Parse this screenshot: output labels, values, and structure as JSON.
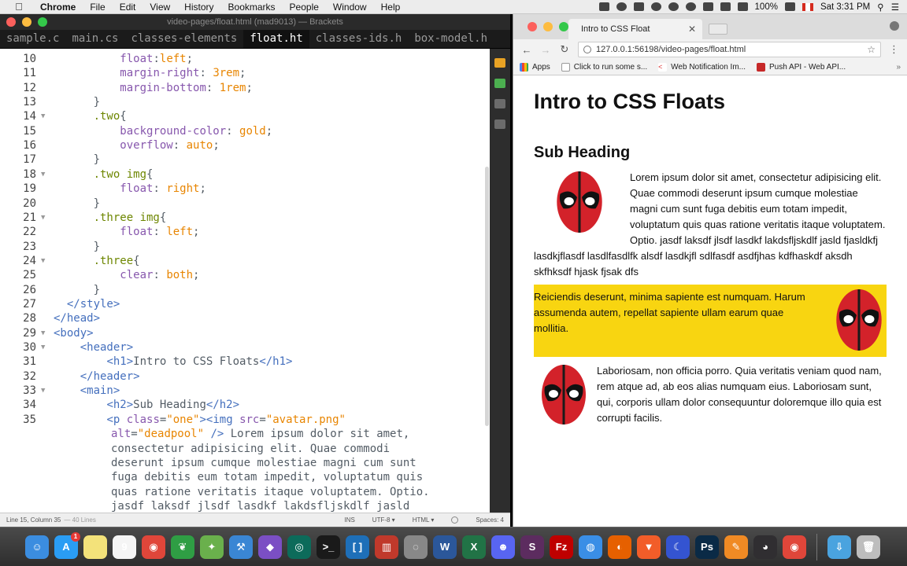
{
  "menubar": {
    "apple": "",
    "items": [
      "Chrome",
      "File",
      "Edit",
      "View",
      "History",
      "Bookmarks",
      "People",
      "Window",
      "Help"
    ],
    "battery": "100%",
    "clock": "Sat 3:31 PM"
  },
  "editor": {
    "window_title": "video-pages/float.html (mad9013) — Brackets",
    "tabs": [
      "sample.c",
      "main.cs",
      "classes-elements",
      "float.ht",
      "classes-ids.h",
      "box-model.h"
    ],
    "active_tab_index": 3,
    "lines": [
      {
        "n": "10",
        "fold": "",
        "html": "          <span class=\"kw\">float</span>:<span class=\"str\">left</span>;"
      },
      {
        "n": "11",
        "fold": "",
        "html": "          <span class=\"kw\">margin-right</span>: <span class=\"str\">3rem</span>;"
      },
      {
        "n": "12",
        "fold": "",
        "html": "          <span class=\"kw\">margin-bottom</span>: <span class=\"str\">1rem</span>;"
      },
      {
        "n": "13",
        "fold": "",
        "html": "      }"
      },
      {
        "n": "14",
        "fold": "▼",
        "html": "      <span class=\"sel\">.two</span>{"
      },
      {
        "n": "15",
        "fold": "",
        "html": "          <span class=\"kw\">background-color</span>: <span class=\"str\">gold</span>;"
      },
      {
        "n": "16",
        "fold": "",
        "html": "          <span class=\"kw\">overflow</span>: <span class=\"str\">auto</span>;"
      },
      {
        "n": "17",
        "fold": "",
        "html": "      }"
      },
      {
        "n": "18",
        "fold": "▼",
        "html": "      <span class=\"sel\">.two img</span>{"
      },
      {
        "n": "19",
        "fold": "",
        "html": "          <span class=\"kw\">float</span>: <span class=\"str\">right</span>;"
      },
      {
        "n": "20",
        "fold": "",
        "html": "      }"
      },
      {
        "n": "21",
        "fold": "▼",
        "html": "      <span class=\"sel\">.three img</span>{"
      },
      {
        "n": "22",
        "fold": "",
        "html": "          <span class=\"kw\">float</span>: <span class=\"str\">left</span>;"
      },
      {
        "n": "23",
        "fold": "",
        "html": "      }"
      },
      {
        "n": "24",
        "fold": "▼",
        "html": "      <span class=\"sel\">.three</span>{"
      },
      {
        "n": "25",
        "fold": "",
        "html": "          <span class=\"kw\">clear</span>: <span class=\"str\">both</span>;"
      },
      {
        "n": "26",
        "fold": "",
        "html": "      }"
      },
      {
        "n": "27",
        "fold": "",
        "html": "  <span class=\"tag\">&lt;/style&gt;</span>"
      },
      {
        "n": "28",
        "fold": "",
        "html": "<span class=\"tag\">&lt;/head&gt;</span>"
      },
      {
        "n": "29",
        "fold": "▼",
        "html": "<span class=\"tag\">&lt;body&gt;</span>"
      },
      {
        "n": "30",
        "fold": "▼",
        "html": "    <span class=\"tag\">&lt;header&gt;</span>"
      },
      {
        "n": "31",
        "fold": "",
        "html": "        <span class=\"tag\">&lt;h1&gt;</span>Intro to CSS Floats<span class=\"tag\">&lt;/h1&gt;</span>"
      },
      {
        "n": "32",
        "fold": "",
        "html": "    <span class=\"tag\">&lt;/header&gt;</span>"
      },
      {
        "n": "33",
        "fold": "▼",
        "html": "    <span class=\"tag\">&lt;main&gt;</span>"
      },
      {
        "n": "34",
        "fold": "",
        "html": "        <span class=\"tag\">&lt;h2&gt;</span>Sub Heading<span class=\"tag\">&lt;/h2&gt;</span>"
      },
      {
        "n": "35",
        "fold": "",
        "html": "        <span class=\"tag\">&lt;p</span> <span class=\"kw\">class</span>=<span class=\"str\">\"one\"</span><span class=\"tag\">&gt;&lt;img</span> <span class=\"kw\">src</span>=<span class=\"str\">\"avatar.png\"</span>"
      }
    ],
    "wrapped_html": "<span class=\"kw\">alt</span>=<span class=\"str\">\"deadpool\"</span> <span class=\"tag\">/&gt;</span> Lorem ipsum dolor sit amet,\nconsectetur adipisicing elit. Quae commodi\ndeserunt ipsum cumque molestiae magni cum sunt\nfuga debitis eum totam impedit, voluptatum quis\nquas ratione veritatis itaque voluptatem. Optio.\njasdf laksdf jlsdf lasdkf lakdsfljskdlf jasld",
    "status": {
      "position": "Line 15, Column 35",
      "lines": "— 40 Lines",
      "mode": "INS",
      "encoding": "UTF-8 ▾",
      "language": "HTML ▾",
      "spaces": "Spaces: 4"
    }
  },
  "browser": {
    "tab_title": "Intro to CSS Float",
    "tab_close": "✕",
    "url": "127.0.0.1:56198/video-pages/float.html",
    "bookmarks": [
      "Apps",
      "Click to run some s...",
      "Web Notification Im...",
      "Push API - Web API..."
    ],
    "page": {
      "h1": "Intro to CSS Floats",
      "h2": "Sub Heading",
      "p_one": "Lorem ipsum dolor sit amet, consectetur adipisicing elit. Quae commodi deserunt ipsum cumque molestiae magni cum sunt fuga debitis eum totam impedit, voluptatum quis quas ratione veritatis itaque voluptatem. Optio. jasdf laksdf jlsdf lasdkf lakdsfljskdlf jasld fjasldkfj lasdkjflasdf lasdlfasdlfk alsdf lasdkjfl sdlfasdf asdfjhas kdfhaskdf aksdh skfhksdf hjask fjsak dfs",
      "p_two": "Reiciendis deserunt, minima sapiente est numquam. Harum assumenda autem, repellat sapiente ullam earum quae mollitia.",
      "p_three": "Laboriosam, non officia porro. Quia veritatis veniam quod nam, rem atque ad, ab eos alias numquam eius. Laboriosam sunt, qui, corporis ullam dolor consequuntur doloremque illo quia est corrupti facilis.",
      "gold_color": "#f8d511"
    }
  },
  "dock": [
    {
      "name": "finder-icon",
      "color": "#3b8de0",
      "glyph": "☺"
    },
    {
      "name": "app-store-icon",
      "color": "#2a9df4",
      "glyph": "A",
      "badge": "1"
    },
    {
      "name": "notes-icon",
      "color": "#f3e27a",
      "glyph": ""
    },
    {
      "name": "calendar-icon",
      "color": "#f5f5f5",
      "glyph": "9"
    },
    {
      "name": "chrome-icon",
      "color": "#e0463a",
      "glyph": "◉"
    },
    {
      "name": "leaf-icon",
      "color": "#2f9e44",
      "glyph": "❦"
    },
    {
      "name": "sourcetree-icon",
      "color": "#6ab04c",
      "glyph": "✦"
    },
    {
      "name": "xcode-icon",
      "color": "#3a86d4",
      "glyph": "⚒"
    },
    {
      "name": "github-icon",
      "color": "#7b4fc4",
      "glyph": "◆"
    },
    {
      "name": "gitkraken-icon",
      "color": "#0c6b5a",
      "glyph": "◎"
    },
    {
      "name": "terminal-icon",
      "color": "#1a1a1a",
      "glyph": ">_"
    },
    {
      "name": "brackets-icon",
      "color": "#1e6fb8",
      "glyph": "[ ]"
    },
    {
      "name": "books-icon",
      "color": "#c0392b",
      "glyph": "▥"
    },
    {
      "name": "sequel-icon",
      "color": "#888",
      "glyph": "◌"
    },
    {
      "name": "word-icon",
      "color": "#2b579a",
      "glyph": "W"
    },
    {
      "name": "excel-icon",
      "color": "#217346",
      "glyph": "X"
    },
    {
      "name": "discord-icon",
      "color": "#5865f2",
      "glyph": "☻"
    },
    {
      "name": "slack-icon",
      "color": "#5c2c5f",
      "glyph": "S"
    },
    {
      "name": "filezilla-icon",
      "color": "#bf0000",
      "glyph": "Fz"
    },
    {
      "name": "safari-icon",
      "color": "#3a8ee6",
      "glyph": "◍"
    },
    {
      "name": "firefox-icon",
      "color": "#e66000",
      "glyph": "◐"
    },
    {
      "name": "brave-icon",
      "color": "#f25d29",
      "glyph": "▼"
    },
    {
      "name": "moon-icon",
      "color": "#3454d1",
      "glyph": "☾"
    },
    {
      "name": "photoshop-icon",
      "color": "#0a2a46",
      "glyph": "Ps"
    },
    {
      "name": "pen-icon",
      "color": "#f08a24",
      "glyph": "✎"
    },
    {
      "name": "obs-icon",
      "color": "#302e31",
      "glyph": "◕"
    },
    {
      "name": "chrome-dev-icon",
      "color": "#e0463a",
      "glyph": "◉"
    }
  ],
  "dock_right": [
    {
      "name": "downloads-icon",
      "color": "#4aa3df",
      "glyph": "⇩"
    },
    {
      "name": "trash-icon",
      "color": "#bdbdbd",
      "glyph": "🗑"
    }
  ]
}
